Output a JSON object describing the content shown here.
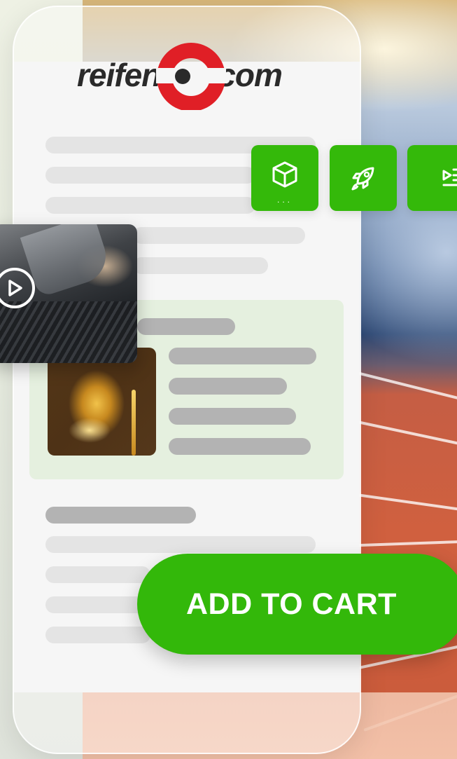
{
  "brand": {
    "logo_left": "reifen",
    "logo_right": "com",
    "ring_color": "#e01f26",
    "text_color": "#2a2a2a"
  },
  "features": [
    {
      "icon": "package-icon",
      "indicator": "..."
    },
    {
      "icon": "rocket-icon"
    },
    {
      "icon": "list-indent-icon"
    }
  ],
  "video": {
    "icon": "play-icon"
  },
  "cart": {
    "label": "ADD TO CART"
  },
  "colors": {
    "accent_green": "#34b90a",
    "product_card_bg": "#e5f0df",
    "placeholder_light": "#e4e4e4",
    "placeholder_dark": "#b3b3b3"
  }
}
